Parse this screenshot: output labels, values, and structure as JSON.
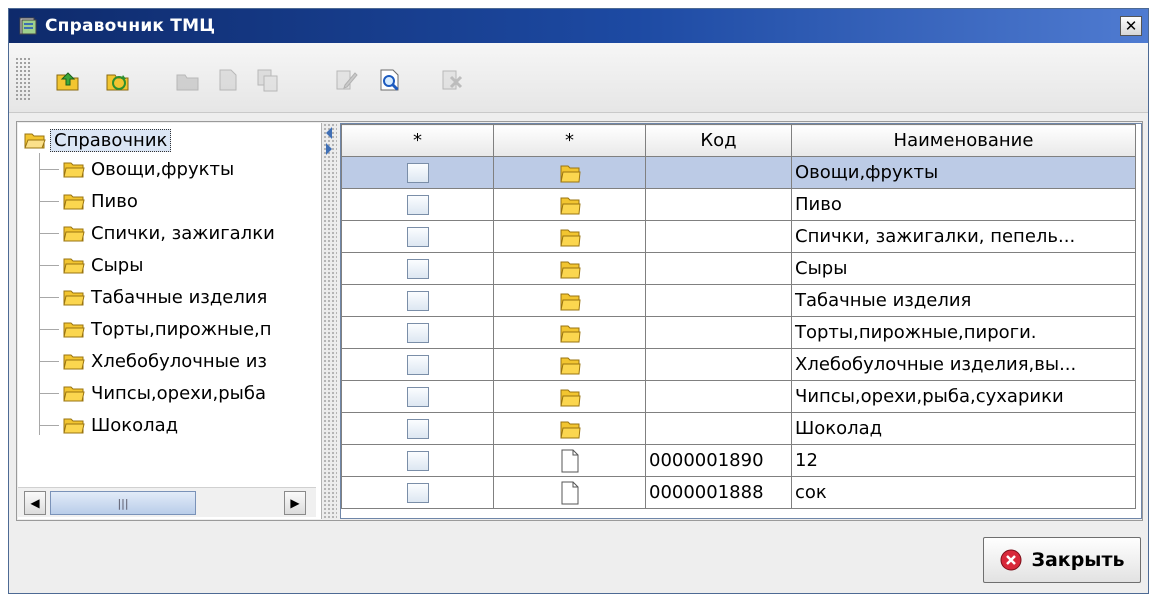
{
  "window": {
    "title": "Справочник ТМЦ",
    "close_glyph": "✕"
  },
  "toolbar": {
    "buttons": [
      {
        "icon": "folder-up-icon",
        "enabled": true
      },
      {
        "icon": "folder-refresh-icon",
        "enabled": true
      },
      {
        "icon": "add-folder-icon",
        "enabled": false
      },
      {
        "icon": "new-document-icon",
        "enabled": false
      },
      {
        "icon": "copy-document-icon",
        "enabled": false
      },
      {
        "icon": "edit-document-icon",
        "enabled": false
      },
      {
        "icon": "view-document-icon",
        "enabled": true
      },
      {
        "icon": "delete-document-icon",
        "enabled": false
      }
    ]
  },
  "tree": {
    "root_label": "Справочник",
    "items": [
      "Овощи,фрукты",
      "Пиво",
      "Спички, зажигалки",
      "Сыры",
      "Табачные изделия",
      "Торты,пирожные,п",
      "Хлебобулочные из",
      "Чипсы,орехи,рыба",
      "Шоколад"
    ]
  },
  "table": {
    "headers": [
      "*",
      "*",
      "Код",
      "Наименование"
    ],
    "rows": [
      {
        "type": "folder",
        "code": "",
        "name": "Овощи,фрукты",
        "selected": true
      },
      {
        "type": "folder",
        "code": "",
        "name": "Пиво",
        "selected": false
      },
      {
        "type": "folder",
        "code": "",
        "name": "Спички, зажигалки, пепель...",
        "selected": false
      },
      {
        "type": "folder",
        "code": "",
        "name": "Сыры",
        "selected": false
      },
      {
        "type": "folder",
        "code": "",
        "name": "Табачные изделия",
        "selected": false
      },
      {
        "type": "folder",
        "code": "",
        "name": "Торты,пирожные,пироги.",
        "selected": false
      },
      {
        "type": "folder",
        "code": "",
        "name": "Хлебобулочные изделия,вы...",
        "selected": false
      },
      {
        "type": "folder",
        "code": "",
        "name": "Чипсы,орехи,рыба,сухарики",
        "selected": false
      },
      {
        "type": "folder",
        "code": "",
        "name": "Шоколад",
        "selected": false
      },
      {
        "type": "document",
        "code": "0000001890",
        "name": "12",
        "selected": false
      },
      {
        "type": "document",
        "code": "0000001888",
        "name": "сок",
        "selected": false
      }
    ]
  },
  "footer": {
    "close_label": "Закрыть"
  },
  "colors": {
    "selection": "#bccbe6",
    "titlebar": "#1d4aa3",
    "folder": "#f2c530"
  }
}
